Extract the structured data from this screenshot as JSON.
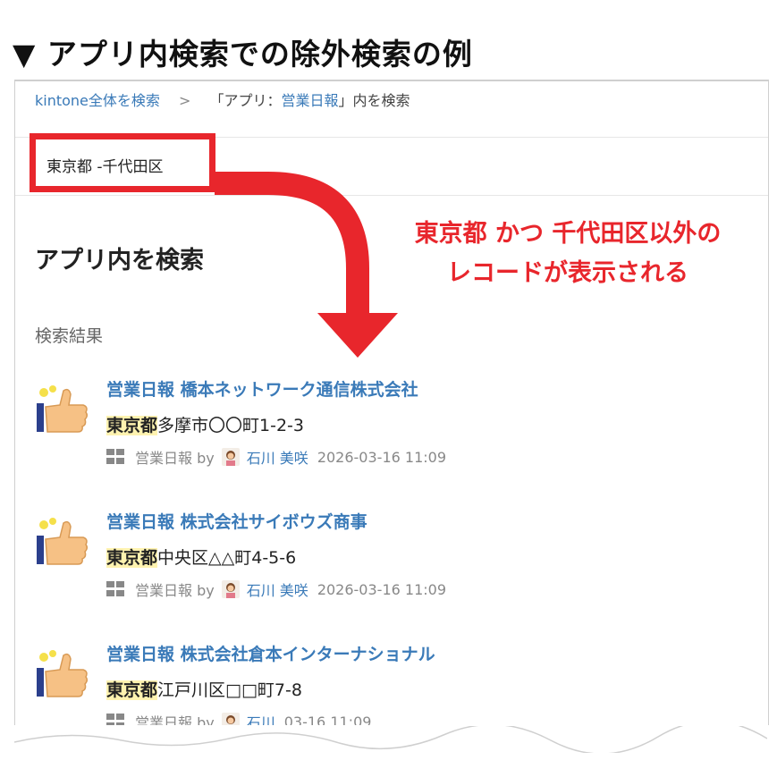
{
  "heading": "▼ アプリ内検索での除外検索の例",
  "breadcrumb": {
    "root": "kintone全体を検索",
    "separator": ">",
    "current_prefix": "「アプリ：",
    "current_app": "営業日報",
    "current_suffix": "」内を検索"
  },
  "search": {
    "query": "東京都 -千代田区"
  },
  "page_title": "アプリ内を検索",
  "section_label": "検索結果",
  "callout": {
    "line1": "東京都 かつ 千代田区以外の",
    "line2": "レコードが表示される"
  },
  "results": [
    {
      "title": "営業日報 橋本ネットワーク通信株式会社",
      "highlight": "東京都",
      "body_rest": "多摩市〇〇町1-2-3",
      "meta_app": "営業日報 by",
      "meta_user": "石川 美咲",
      "meta_date": "2026-03-16 11:09"
    },
    {
      "title": "営業日報 株式会社サイボウズ商事",
      "highlight": "東京都",
      "body_rest": "中央区△△町4-5-6",
      "meta_app": "営業日報 by",
      "meta_user": "石川 美咲",
      "meta_date": "2026-03-16 11:09"
    },
    {
      "title": "営業日報 株式会社倉本インターナショナル",
      "highlight": "東京都",
      "body_rest": "江戸川区□□町7-8",
      "meta_app": "営業日報 by",
      "meta_user": "石川",
      "meta_date": "03-16 11:09"
    }
  ],
  "colors": {
    "accent_red": "#e8262c",
    "link_blue": "#3a7ab8",
    "highlight": "#fff3b0"
  },
  "icons": [
    "thumbs-up-icon",
    "app-grid-icon",
    "avatar-icon",
    "arrow-curved-down-icon"
  ]
}
